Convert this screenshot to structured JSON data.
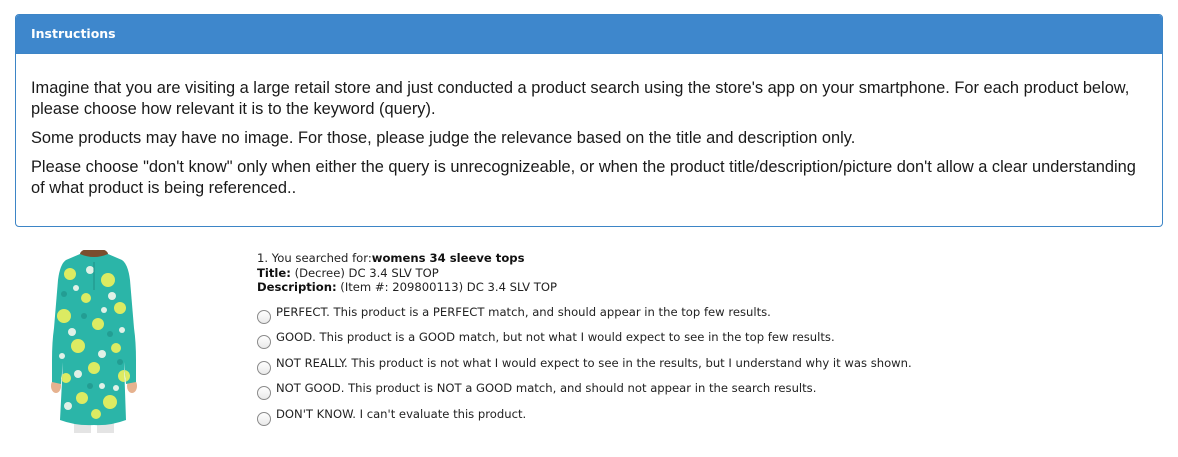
{
  "instructions": {
    "title": "Instructions",
    "paragraphs": [
      "Imagine that you are visiting a large retail store and just conducted a product search using the store's app on your smartphone.  For each product below, please choose how relevant it is to the keyword (query).",
      "Some products may have no image. For those, please judge the relevance based on the title and description only.",
      "Please choose \"don't know\" only when either the query is unrecognizeable, or when the product title/description/picture don't allow a clear understanding of what product is being referenced.."
    ]
  },
  "question": {
    "prefix": "1. You searched for:",
    "query": "womens 34 sleeve tops",
    "title_label": "Title:",
    "title_value": " (Decree) DC 3.4 SLV TOP",
    "description_label": "Description:",
    "description_value": " (Item #: 209800113) DC 3.4 SLV TOP",
    "options": [
      {
        "label": "PERFECT. This product is a PERFECT match, and should appear in the top few results.",
        "selected": false
      },
      {
        "label": "GOOD. This product is a GOOD match, but not what I would expect to see in the top few results.",
        "selected": false
      },
      {
        "label": "NOT REALLY. This product is not what I would expect to see in the results, but I understand why it was shown.",
        "selected": false
      },
      {
        "label": "NOT GOOD. This product is NOT a GOOD match, and should not appear in the search results.",
        "selected": false
      },
      {
        "label": "DON'T KNOW. I can't evaluate this product.",
        "selected": false
      }
    ]
  },
  "colors": {
    "header_bg": "#3e87cc",
    "border": "#3d85c6",
    "shirt_base": "#2bb5a8",
    "shirt_pattern_yellow": "#e6ef5e",
    "shirt_pattern_white": "#f4f8ee"
  }
}
